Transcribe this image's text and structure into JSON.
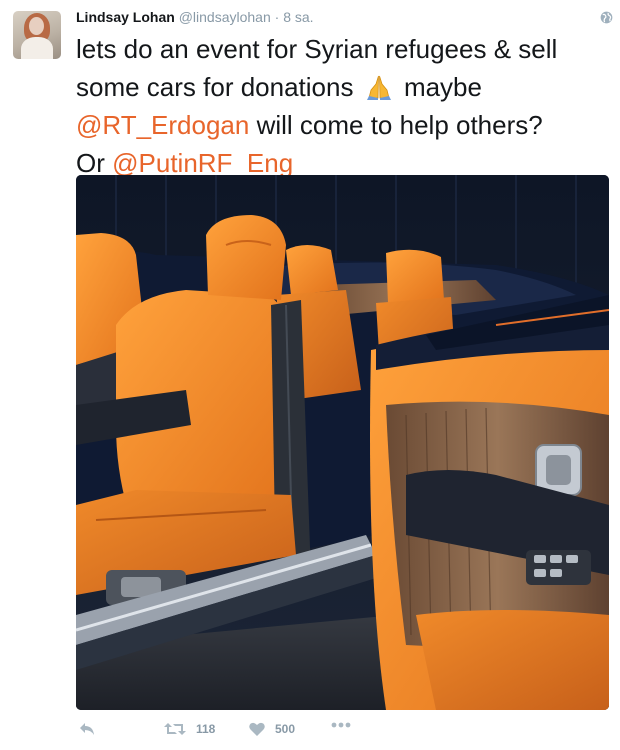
{
  "tweet": {
    "author": {
      "name": "Lindsay Lohan",
      "handle": "@lindsaylohan"
    },
    "separator": "·",
    "time": "8 sa.",
    "text_parts": {
      "line1": "lets do an event for Syrian refugees & sell",
      "line2a": "some cars for donations",
      "line2b": "maybe",
      "mention1": "@RT_Erdogan",
      "line3b": "will come to help others?",
      "line4a": "Or",
      "mention2": "@PutinRF_Eng"
    },
    "emoji": "folded-hands-emoji",
    "media": {
      "kind": "photo",
      "subject": "convertible-car-orange-interior"
    },
    "actions": {
      "retweet_count": "118",
      "like_count": "500"
    }
  },
  "colors": {
    "mention": "#e8652b",
    "muted": "#8899a6",
    "text": "#14171a",
    "leather": "#f08a2a"
  }
}
